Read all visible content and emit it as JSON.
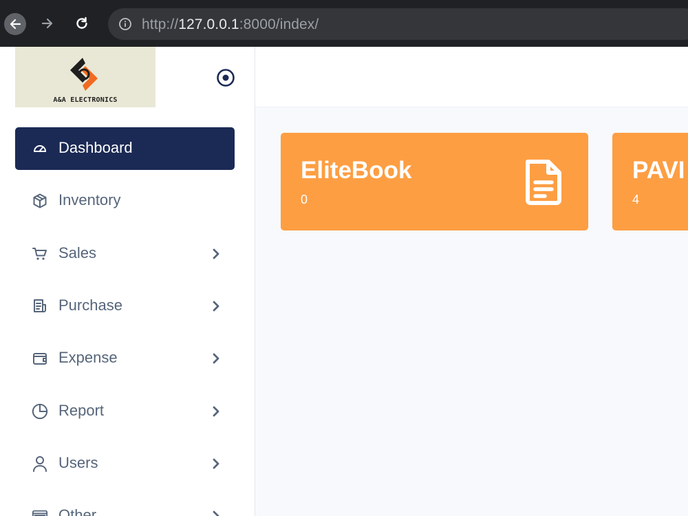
{
  "browser": {
    "url_scheme": "http://",
    "url_host": "127.0.0.1",
    "url_rest": ":8000/index/"
  },
  "sidebar": {
    "logo_text": "A&A ELECTRONICS",
    "items": [
      {
        "label": "Dashboard",
        "icon": "gauge-icon",
        "active": true,
        "has_submenu": false
      },
      {
        "label": "Inventory",
        "icon": "box-icon",
        "active": false,
        "has_submenu": false
      },
      {
        "label": "Sales",
        "icon": "cart-icon",
        "active": false,
        "has_submenu": true
      },
      {
        "label": "Purchase",
        "icon": "receipt-icon",
        "active": false,
        "has_submenu": true
      },
      {
        "label": "Expense",
        "icon": "wallet-icon",
        "active": false,
        "has_submenu": true
      },
      {
        "label": "Report",
        "icon": "pie-chart-icon",
        "active": false,
        "has_submenu": true
      },
      {
        "label": "Users",
        "icon": "user-icon",
        "active": false,
        "has_submenu": true
      },
      {
        "label": "Other",
        "icon": "window-icon",
        "active": false,
        "has_submenu": true
      }
    ]
  },
  "cards": [
    {
      "title": "EliteBook",
      "value": "0",
      "icon": "document-icon"
    },
    {
      "title": "PAVI",
      "value": "4"
    }
  ],
  "colors": {
    "card_bg": "#fd9e43",
    "active_menu_bg": "#1b2a55",
    "menu_text": "#56657a",
    "browser_bg": "#202124"
  }
}
